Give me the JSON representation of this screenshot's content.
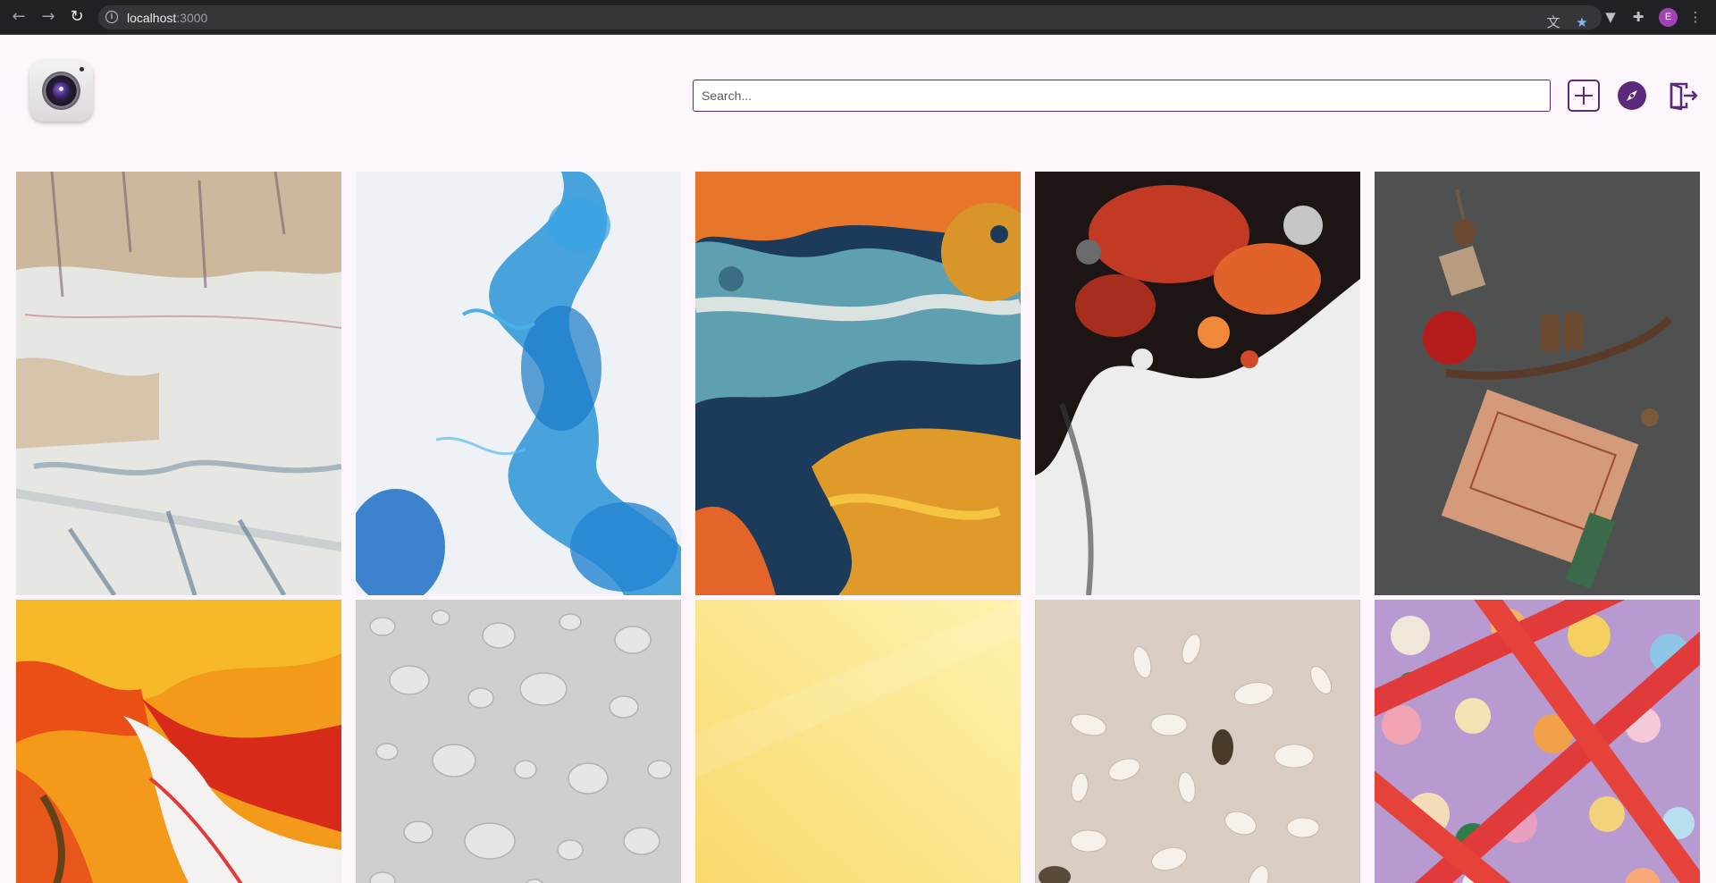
{
  "browser": {
    "url_host": "localhost",
    "url_port": ":3000",
    "profile_initial": "E",
    "icons": [
      "back-arrow-icon",
      "forward-arrow-icon",
      "reload-icon",
      "info-icon",
      "translate-icon",
      "star-icon",
      "extension-v-icon",
      "puzzle-icon",
      "kebab-menu-icon"
    ]
  },
  "header": {
    "logo_icon": "camera-lens-icon",
    "search_placeholder": "Search...",
    "search_value": "",
    "add_icon": "plus-square-icon",
    "explore_icon": "compass-icon",
    "logout_icon": "logout-door-icon",
    "accent_color": "#5b2a7a"
  },
  "gallery": {
    "images": [
      {
        "subject": "textured white and tan paint",
        "icon": "image"
      },
      {
        "subject": "blue ink in water",
        "icon": "image"
      },
      {
        "subject": "orange and teal fluid art",
        "icon": "image"
      },
      {
        "subject": "red black and white fluid art",
        "icon": "image"
      },
      {
        "subject": "balanced apple, binoculars and box still life",
        "icon": "image"
      },
      {
        "subject": "orange and red fluid art",
        "icon": "image"
      },
      {
        "subject": "water droplets on white",
        "icon": "image"
      },
      {
        "subject": "pale yellow gradient",
        "icon": "image"
      },
      {
        "subject": "cowrie shells on beige",
        "icon": "image"
      },
      {
        "subject": "candies and red licorice",
        "icon": "image"
      }
    ]
  }
}
